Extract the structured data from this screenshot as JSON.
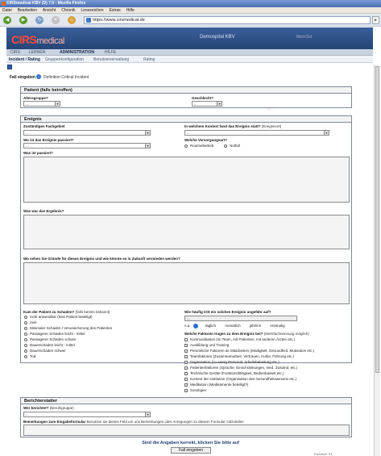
{
  "window": {
    "title": "CIRSmedical KBV (D) 7.0 - Mozilla Firefox"
  },
  "menubar": [
    "Datei",
    "Bearbeiten",
    "Ansicht",
    "Chronik",
    "Lesezeichen",
    "Extras",
    "Hilfe"
  ],
  "browser": {
    "url": "https://www.cirsmedical.de"
  },
  "app": {
    "logo_main": "CIRS",
    "logo_sub": "medical",
    "hospital": "Demospital KBV",
    "user": "Med-Ost",
    "main_nav": [
      "CIRS",
      "LERNEN",
      "ADMINISTRATION",
      "HILFE"
    ],
    "active_main_nav": "ADMINISTRATION",
    "sub_nav": [
      "Incident / Rating",
      "Gruppenkonfiguration",
      "Benutzerverwaltung",
      "Rating"
    ]
  },
  "form": {
    "title": "Fall eingeben",
    "info_link": "Definition Critical Incident",
    "patient": {
      "header": "Patient (falls betroffen)",
      "age_label": "Altersgruppe?",
      "age_value": "...",
      "gender_label": "Geschlecht?",
      "gender_value": "..."
    },
    "event": {
      "header": "Ereignis",
      "department_label": "Zuständiges Fachgebiet",
      "department_value": "...",
      "context_label": "In welchem Kontext fand das Ereignis statt?",
      "context_hint": "(Ereignisort)",
      "context_value": "...",
      "location_label": "Wo ist das Ereignis passiert?",
      "location_value": "...",
      "care_label": "Welche Versorgungsart?",
      "care_options": [
        "Routinebetrieb",
        "Notfall"
      ],
      "what_label": "Was ist passiert?",
      "result_label": "Was war das Ergebnis?",
      "reasons_label": "Wo sehen Sie Gründe für dieses Ereignis und wie könnte es in Zukunft vermieden werden?",
      "harm_label": "Kam der Patient zu Schaden?",
      "harm_hint": "(falls bereits bekannt)",
      "harm_options": [
        "nicht anwendbar (kein Patient beteiligt)",
        "nein",
        "Minimaler Schaden / Verunsicherung des Patienten",
        "Passagerer Schaden leicht - mittel",
        "Passagerer Schaden schwer",
        "Dauerschaden leicht - mittel",
        "Dauerschaden schwer",
        "Tod"
      ],
      "frequency_label": "Wie häufig tritt ein solches Ereignis ungefähr auf?",
      "frequency_value": "...",
      "frequency_scale": [
        "n.a.",
        "täglich",
        "monatlich",
        "jährlich",
        "erstmalig"
      ],
      "factors_label": "Welche Faktoren trugen zu dem Ereignis bei?",
      "factors_hint": "(Mehrfachnennung möglich)",
      "factors": [
        "Kommunikation (im Team, mit Patienten, mit anderen Ärzten etc.)",
        "Ausbildung und Training",
        "Persönliche Faktoren de Mitarbeiters (Müdigkeit, Gesundheit, Motivation etc.)",
        "Teamfaktoren (Zusammenarbeit, Vertrauen, Kultur, Führung etc.)",
        "Organisation (zu wenig Personal, Arbeitsbelastung etc.)",
        "Patientenfaktoren (Sprache, Einschränkungen, med. Zustand. etc.)",
        "Technische Geräte (Funktionsfähigkeit, Bedienbarkeit etc.)",
        "Kontext der Institution (Organisation des Gesundheitswesens etc.)",
        "Medikation (Medikamente beteiligt?)",
        "Sonstiges:"
      ]
    },
    "reporter": {
      "header": "Berichterstatter",
      "who_label": "Wer berichtet?",
      "who_hint": "(Berufsgruppe)",
      "who_value": "...",
      "remarks_label": "Bemerkungen zum Eingabeformular",
      "remarks_hint": "Benutzen sie dieses Feld um uns Bemerkungen oder Anregungen zu diesem Formular mitzuteilen"
    },
    "submit_question": "Sind die Angaben korrekt, klicken Sie bitte auf",
    "submit_button": "Fall eingeben"
  },
  "statusbar": {
    "text": "Protokoll: S1"
  },
  "watermark": "cirs system"
}
